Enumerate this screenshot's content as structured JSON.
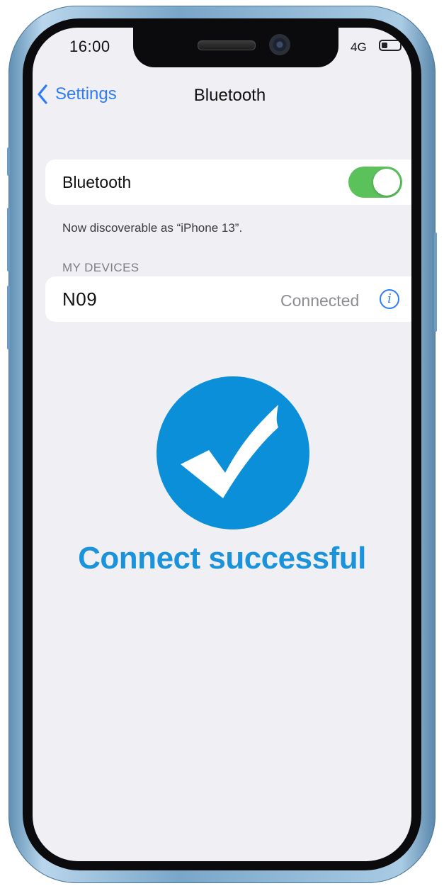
{
  "status_bar": {
    "time": "16:00",
    "network": "4G",
    "battery_level": 0.35
  },
  "nav": {
    "back_label": "Settings",
    "title": "Bluetooth"
  },
  "bluetooth": {
    "label": "Bluetooth",
    "enabled": true,
    "discoverable_text": "Now discoverable as “iPhone 13”."
  },
  "devices_section": {
    "header": "MY DEVICES",
    "items": [
      {
        "name": "N09",
        "status": "Connected"
      }
    ]
  },
  "overlay": {
    "message": "Connect successful"
  },
  "colors": {
    "accent": "#2f7cf6",
    "toggle_on": "#5bc15a",
    "success_blue": "#0b8fd9",
    "background": "#efeff4"
  },
  "icons": {
    "back": "chevron-left-icon",
    "info": "info-icon",
    "success": "checkmark-circle-icon"
  }
}
